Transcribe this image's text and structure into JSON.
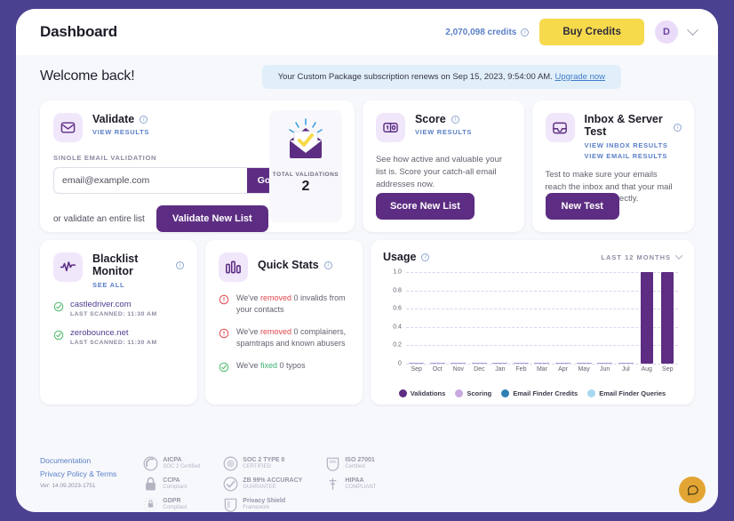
{
  "header": {
    "title": "Dashboard",
    "credits": "2,070,098 credits",
    "credits_info_icon": "info-icon",
    "buy_button": "Buy Credits",
    "avatar_initial": "D",
    "chevron_icon": "chevron-down-icon"
  },
  "welcome": {
    "greeting": "Welcome back!",
    "banner_text": "Your Custom Package subscription renews on Sep 15, 2023, 9:54:00 AM.",
    "banner_link": "Upgrade now"
  },
  "validate": {
    "title": "Validate",
    "view_results": "VIEW RESULTS",
    "single_label": "SINGLE EMAIL VALIDATION",
    "email_placeholder": "email@example.com",
    "email_value": "",
    "go_button": "Go",
    "or_text": "or validate an entire list",
    "primary_button": "Validate New List",
    "total_label": "TOTAL VALIDATIONS",
    "total_value": "2",
    "icon": "envelope-icon"
  },
  "score": {
    "title": "Score",
    "view_results": "VIEW RESULTS",
    "body": "See how active and valuable your list is. Score your catch-all email addresses now.",
    "primary_button": "Score New List",
    "icon": "score-10-icon"
  },
  "inbox": {
    "title": "Inbox & Server Test",
    "link_inbox": "VIEW INBOX RESULTS",
    "link_email": "VIEW EMAIL RESULTS",
    "body": "Test to make sure your emails reach the inbox and that your mail server is set up correctly.",
    "primary_button": "New Test",
    "icon": "inbox-tray-icon"
  },
  "blacklist": {
    "title": "Blacklist Monitor",
    "see_all": "SEE ALL",
    "icon": "pulse-icon",
    "items": [
      {
        "domain": "castledriver.com",
        "scanned": "LAST SCANNED: 11:30 AM",
        "status_icon": "check-circle-icon"
      },
      {
        "domain": "zerobounce.net",
        "scanned": "LAST SCANNED: 11:30 AM",
        "status_icon": "check-circle-icon"
      }
    ]
  },
  "quick_stats": {
    "title": "Quick Stats",
    "icon": "bar-chart-icon",
    "items": [
      {
        "icon": "alert-circle-icon",
        "tone": "red",
        "pre": "We've ",
        "highlight": "removed",
        "post": " 0 invalids from your contacts"
      },
      {
        "icon": "alert-circle-icon",
        "tone": "red",
        "pre": "We've ",
        "highlight": "removed",
        "post": " 0 complainers, spamtraps and known abusers"
      },
      {
        "icon": "check-circle-icon",
        "tone": "green",
        "pre": "We've ",
        "highlight": "fixed",
        "post": " 0 typos"
      }
    ]
  },
  "usage": {
    "title": "Usage",
    "range_label": "LAST 12 MONTHS",
    "range_chevron": "chevron-down-icon"
  },
  "chart_data": {
    "type": "bar",
    "title": "Usage",
    "xlabel": "",
    "ylabel": "",
    "ylim": [
      0,
      1.0
    ],
    "yticks": [
      "0",
      "0.2",
      "0.4",
      "0.6",
      "0.8",
      "1.0"
    ],
    "grid": true,
    "legend_position": "bottom",
    "categories": [
      "Sep",
      "Oct",
      "Nov",
      "Dec",
      "Jan",
      "Feb",
      "Mar",
      "Apr",
      "May",
      "Jun",
      "Jul",
      "Aug",
      "Sep"
    ],
    "series": [
      {
        "name": "Validations",
        "color": "#5c2d82",
        "values": [
          0,
          0,
          0,
          0,
          0,
          0,
          0,
          0,
          0,
          0,
          0,
          1.0,
          1.0
        ]
      },
      {
        "name": "Scoring",
        "color": "#c9a8e0",
        "values": [
          0,
          0,
          0,
          0,
          0,
          0,
          0,
          0,
          0,
          0,
          0,
          0,
          0
        ]
      },
      {
        "name": "Email Finder Credits",
        "color": "#2f7fb5",
        "values": [
          0,
          0,
          0,
          0,
          0,
          0,
          0,
          0,
          0,
          0,
          0,
          0,
          0
        ]
      },
      {
        "name": "Email Finder Queries",
        "color": "#a8d8f0",
        "values": [
          0,
          0,
          0,
          0,
          0,
          0,
          0,
          0,
          0,
          0,
          0,
          0,
          0
        ]
      }
    ]
  },
  "footer": {
    "documentation": "Documentation",
    "privacy": "Privacy Policy & Terms",
    "version": "Ver: 14.09.2023-1751",
    "chat_icon": "chat-bubble-icon",
    "badges": [
      {
        "icon": "aicpa-icon",
        "line1": "AICPA",
        "line2": "SOC 2 Certified"
      },
      {
        "icon": "soc2-icon",
        "line1": "SOC 2 TYPE II",
        "line2": "CERTIFIED"
      },
      {
        "icon": "iso-icon",
        "line1": "ISO 27001",
        "line2": "Certified"
      },
      {
        "icon": "hipaa-icon",
        "line1": "HIPAA",
        "line2": "COMPLIANT"
      },
      {
        "icon": "gdpr-icon",
        "line1": "GDPR",
        "line2": "Compliant"
      },
      {
        "icon": "privacy-shield-icon",
        "line1": "Privacy Shield",
        "line2": "Framework"
      },
      {
        "icon": "ccpa-icon",
        "line1": "CCPA",
        "line2": "Compliant"
      },
      {
        "icon": "zb-guarantee-icon",
        "line1": "ZB 99% ACCURACY",
        "line2": "GUARANTEE"
      }
    ]
  }
}
